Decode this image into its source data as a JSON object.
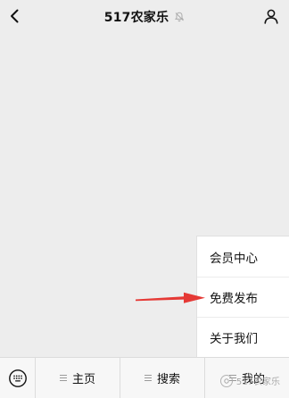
{
  "app": {
    "title": "517农家乐"
  },
  "popup": {
    "items": [
      {
        "label": "会员中心"
      },
      {
        "label": "免费发布"
      },
      {
        "label": "关于我们"
      }
    ]
  },
  "bottom_menu": {
    "tabs": [
      {
        "label": "主页"
      },
      {
        "label": "搜索"
      },
      {
        "label": "我的"
      }
    ]
  },
  "watermark": {
    "text": "517农家乐"
  },
  "colors": {
    "background": "#ededed",
    "arrow": "#e53935"
  },
  "icons": {
    "back": "back-chevron-icon",
    "mute": "muted-bell-icon",
    "profile": "person-icon",
    "keyboard": "keyboard-icon",
    "menu": "three-lines-icon"
  }
}
